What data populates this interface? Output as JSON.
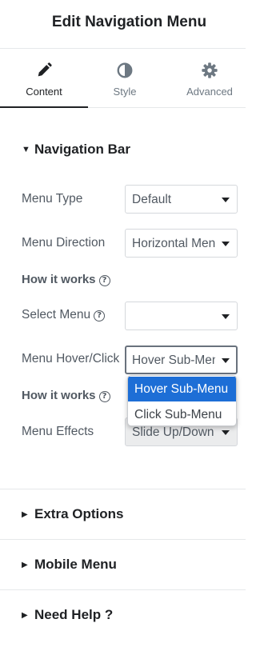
{
  "header": {
    "title": "Edit Navigation Menu"
  },
  "tabs": [
    {
      "label": "Content",
      "icon": "pencil-icon",
      "active": true
    },
    {
      "label": "Style",
      "icon": "contrast-icon",
      "active": false
    },
    {
      "label": "Advanced",
      "icon": "gear-icon",
      "active": false
    }
  ],
  "sections": {
    "navigation_bar": {
      "title": "Navigation Bar",
      "expanded": true,
      "controls": {
        "menu_type": {
          "label": "Menu Type",
          "value": "Default"
        },
        "menu_direction": {
          "label": "Menu Direction",
          "value": "Horizontal Menu"
        },
        "how_it_works_1": {
          "label": "How it works",
          "icon": "help-icon"
        },
        "select_menu": {
          "label": "Select Menu",
          "value": ""
        },
        "menu_hover_click": {
          "label": "Menu Hover/Click",
          "value": "Hover Sub-Menu"
        },
        "how_it_works_2": {
          "label": "How it works",
          "icon": "help-icon"
        },
        "menu_effects": {
          "label": "Menu Effects",
          "value": "Slide Up/Down"
        }
      }
    },
    "extra_options": {
      "title": "Extra Options",
      "expanded": false
    },
    "mobile_menu": {
      "title": "Mobile Menu",
      "expanded": false
    },
    "need_help": {
      "title": "Need Help ?",
      "expanded": false
    }
  },
  "dropdown": {
    "options": [
      "Hover Sub-Menu",
      "Click Sub-Menu"
    ],
    "selected": "Hover Sub-Menu"
  },
  "colors": {
    "accent_selected": "#1d6ed6",
    "text_primary": "#1f2124",
    "text_secondary": "#515962"
  }
}
